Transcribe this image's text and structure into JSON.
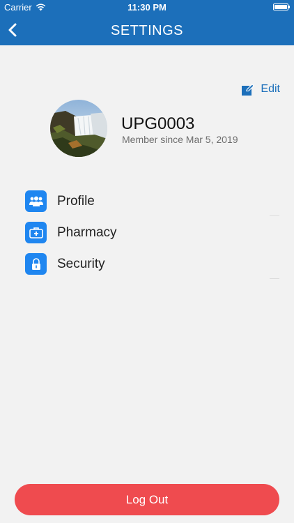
{
  "status_bar": {
    "carrier": "Carrier",
    "time": "11:30 PM"
  },
  "nav": {
    "title": "SETTINGS"
  },
  "profile": {
    "edit_label": "Edit",
    "username": "UPG0003",
    "member_since": "Member since Mar 5, 2019"
  },
  "menu": {
    "items": [
      {
        "label": "Profile",
        "icon": "users-icon"
      },
      {
        "label": "Pharmacy",
        "icon": "medical-kit-icon"
      },
      {
        "label": "Security",
        "icon": "lock-icon"
      }
    ]
  },
  "logout_label": "Log Out",
  "colors": {
    "brand": "#1c6fba",
    "icon_bg": "#1f86f0",
    "logout": "#ef4b4f",
    "background": "#f2f2f2"
  }
}
